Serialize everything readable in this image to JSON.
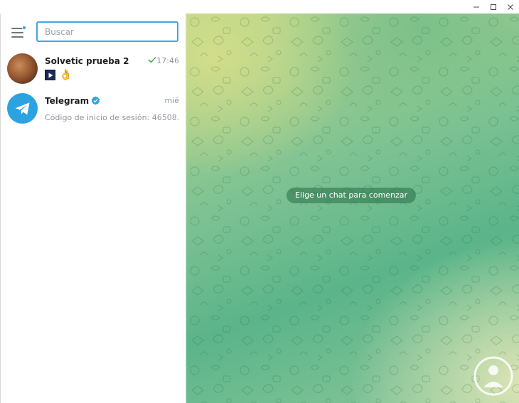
{
  "window": {
    "controls": [
      "minimize-icon",
      "maximize-icon",
      "close-icon"
    ]
  },
  "sidebar": {
    "menu_icon": "hamburger-menu-icon",
    "search": {
      "placeholder": "Buscar",
      "value": ""
    },
    "chats": [
      {
        "name": "Solvetic prueba 2",
        "time": "17:46",
        "status": "sent-check-icon",
        "preview_emoji": "👌",
        "has_media_thumb": true
      },
      {
        "name": "Telegram",
        "verified": true,
        "time": "mié",
        "preview": "Código de inicio de sesión: 46508...."
      }
    ]
  },
  "main": {
    "placeholder_message": "Elige un chat para comenzar"
  },
  "colors": {
    "accent": "#40a7e3",
    "telegram_blue": "#2aa3e0",
    "check_green": "#4fae4e"
  }
}
